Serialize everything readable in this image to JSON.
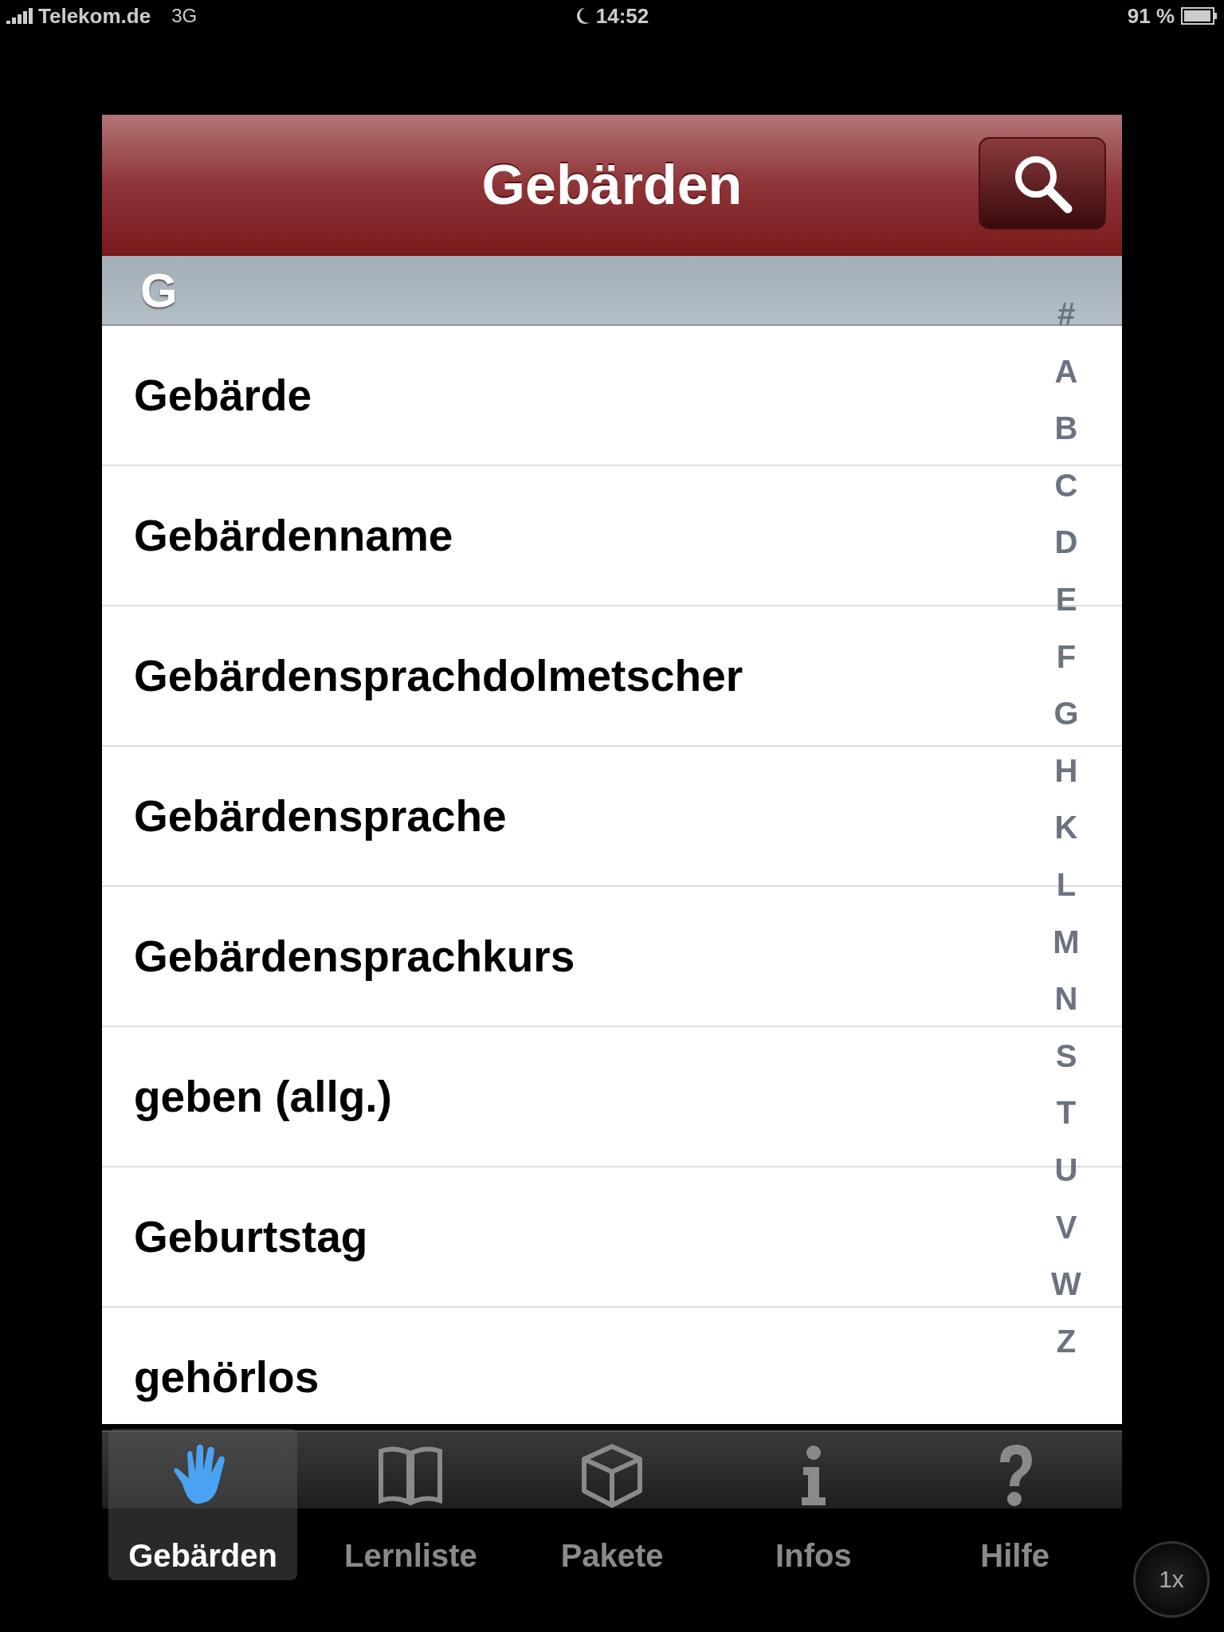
{
  "status_bar": {
    "carrier": "Telekom.de",
    "network": "3G",
    "time": "14:52",
    "battery": "91 %"
  },
  "nav_bar": {
    "title": "Gebärden"
  },
  "section": {
    "letter": "G"
  },
  "rows": [
    {
      "label": "Gebärde"
    },
    {
      "label": "Gebärdenname"
    },
    {
      "label": "Gebärdensprachdolmetscher"
    },
    {
      "label": "Gebärdensprache"
    },
    {
      "label": "Gebärdensprachkurs"
    },
    {
      "label": "geben (allg.)"
    },
    {
      "label": "Geburtstag"
    },
    {
      "label": "gehörlos"
    }
  ],
  "index": [
    "#",
    "A",
    "B",
    "C",
    "D",
    "E",
    "F",
    "G",
    "H",
    "K",
    "L",
    "M",
    "N",
    "S",
    "T",
    "U",
    "V",
    "W",
    "Z"
  ],
  "tabs": [
    {
      "label": "Gebärden",
      "kind": "hand",
      "selected": true
    },
    {
      "label": "Lernliste",
      "kind": "book",
      "selected": false
    },
    {
      "label": "Pakete",
      "kind": "box",
      "selected": false
    },
    {
      "label": "Infos",
      "kind": "info",
      "selected": false
    },
    {
      "label": "Hilfe",
      "kind": "help",
      "selected": false
    }
  ],
  "zoom_button": "1x"
}
